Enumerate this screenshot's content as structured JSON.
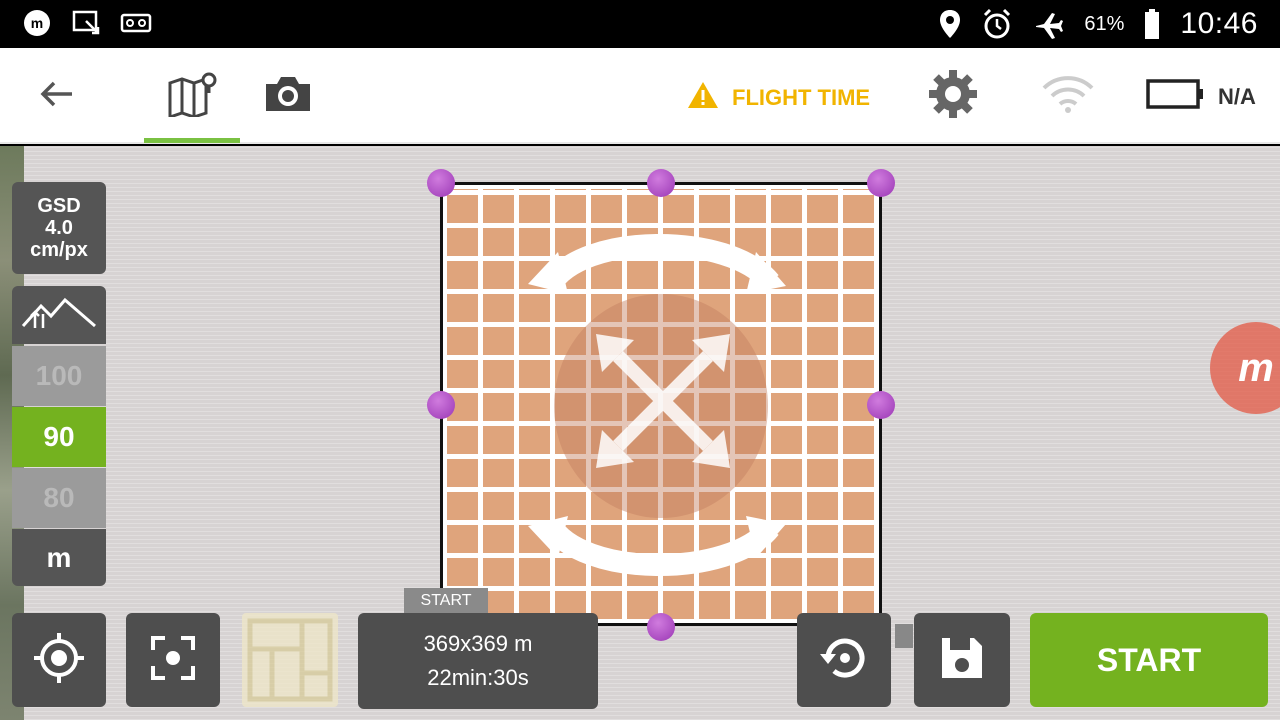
{
  "status_bar": {
    "battery_percent": "61%",
    "time": "10:46",
    "icons": [
      "app-notification-icon",
      "screen-cast-icon",
      "voicemail-icon",
      "location-icon",
      "alarm-icon",
      "airplane-mode-icon",
      "battery-icon"
    ]
  },
  "toolbar": {
    "icons": [
      "back-arrow-icon",
      "map-icon",
      "camera-icon",
      "settings-gear-icon",
      "wifi-icon",
      "drone-battery-icon"
    ],
    "active_tab": "map",
    "flight_time_label": "FLIGHT TIME",
    "drone_battery_label": "N/A",
    "colors": {
      "accent": "#7ac142",
      "warning": "#f1b400"
    }
  },
  "left_panel": {
    "gsd_label": "GSD",
    "gsd_value": "4.0",
    "gsd_unit": "cm/px",
    "altitude_options": [
      "100",
      "90",
      "80"
    ],
    "altitude_selected": "90",
    "altitude_unit": "m"
  },
  "map": {
    "start_badge": "START",
    "survey_size": "369x369 m",
    "flight_duration": "22min:30s",
    "grid_color": "#dfa47c",
    "handle_color": "#b04fcc"
  },
  "bottom_bar": {
    "start_button": "START",
    "start_color": "#74b21f"
  },
  "overlay_button": {
    "letter": "m"
  }
}
